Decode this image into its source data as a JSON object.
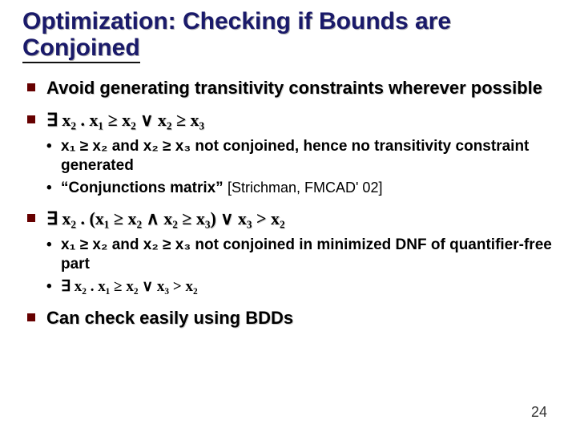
{
  "title_line1": "Optimization: Checking if Bounds are",
  "title_line2": "Conjoined",
  "bullets": [
    {
      "text": "Avoid generating transitivity constraints wherever possible"
    },
    {
      "formula": "∃ x₂ . x₁ ≥ x₂ ∨ x₂ ≥ x₃",
      "sub": [
        "x₁ ≥ x₂ and x₂ ≥ x₃ not conjoined, hence no transitivity constraint generated",
        "“Conjunctions matrix” [Strichman, FMCAD' 02]"
      ],
      "sub_cite_index": 1,
      "sub_cite_prefix": "“Conjunctions matrix” ",
      "sub_cite_cite": "[Strichman, FMCAD' 02]"
    },
    {
      "formula": "∃ x₂ . (x₁ ≥ x₂ ∧ x₂ ≥ x₃) ∨ x₃ > x₂",
      "sub": [
        "x₁ ≥ x₂ and x₂ ≥ x₃ not conjoined in minimized DNF of quantifier-free part",
        "∃ x₂ . x₁ ≥ x₂  ∨  x₃ > x₂"
      ]
    },
    {
      "text": "Can check easily using BDDs"
    }
  ],
  "page_number": "24"
}
